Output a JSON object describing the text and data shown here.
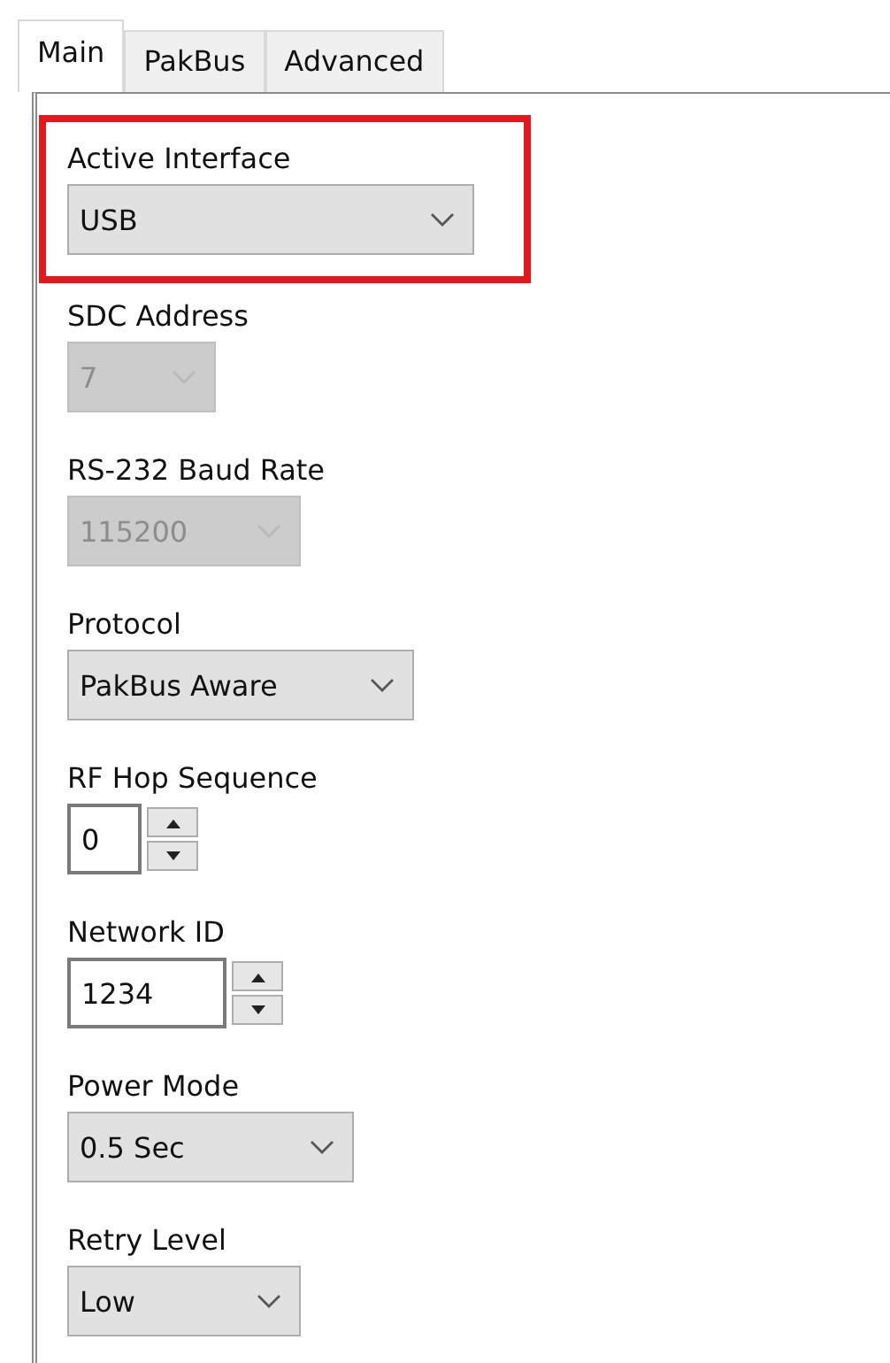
{
  "tabs": [
    {
      "label": "Main",
      "selected": true
    },
    {
      "label": "PakBus",
      "selected": false
    },
    {
      "label": "Advanced",
      "selected": false
    }
  ],
  "fields": [
    {
      "kind": "select",
      "label": "Active Interface",
      "value": "USB",
      "disabled": false,
      "highlighted": true
    },
    {
      "kind": "select",
      "label": "SDC Address",
      "value": "7",
      "disabled": true,
      "highlighted": false
    },
    {
      "kind": "select",
      "label": "RS-232 Baud Rate",
      "value": "115200",
      "disabled": true,
      "highlighted": false
    },
    {
      "kind": "select",
      "label": "Protocol",
      "value": "PakBus Aware",
      "disabled": false,
      "highlighted": false
    },
    {
      "kind": "spin",
      "label": "RF Hop Sequence",
      "value": "0",
      "disabled": false,
      "highlighted": false
    },
    {
      "kind": "spin",
      "label": "Network ID",
      "value": "1234",
      "disabled": false,
      "highlighted": false
    },
    {
      "kind": "select",
      "label": "Power Mode",
      "value": "0.5 Sec",
      "disabled": false,
      "highlighted": false
    },
    {
      "kind": "select",
      "label": "Retry Level",
      "value": "Low",
      "disabled": false,
      "highlighted": false
    }
  ]
}
